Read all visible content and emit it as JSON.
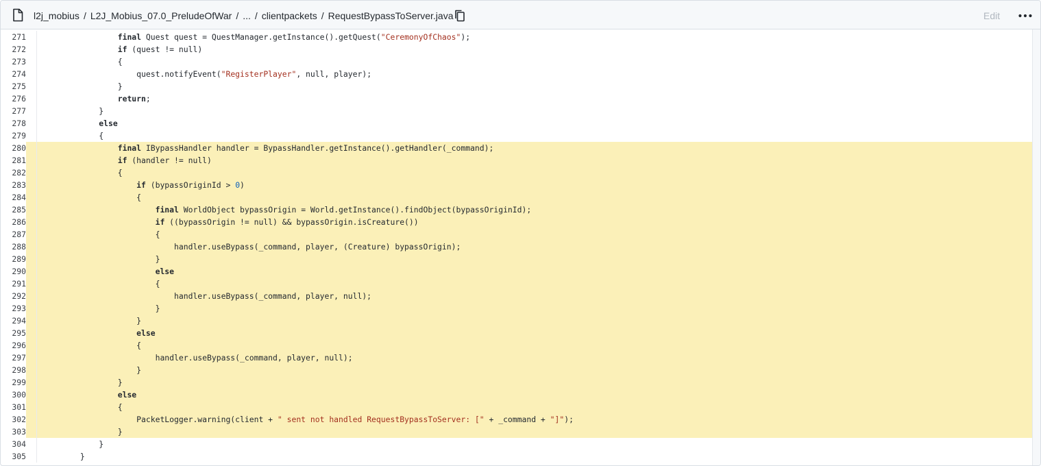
{
  "header": {
    "breadcrumbs": [
      {
        "label": "l2j_mobius"
      },
      {
        "label": "L2J_Mobius_07.0_PreludeOfWar"
      },
      {
        "label": "..."
      },
      {
        "label": "clientpackets"
      }
    ],
    "separator": "/",
    "current_file": "RequestBypassToServer.java",
    "edit_label": "Edit"
  },
  "icons": {
    "file": "file-icon",
    "copy": "copy-icon",
    "more": "kebab-horizontal-icon"
  },
  "colors": {
    "highlight": "#fbf0b8",
    "string": "#a3301f",
    "number": "#0b5fb8",
    "edit_disabled": "#b0b7bf"
  },
  "code": {
    "language": "java",
    "lines": [
      {
        "n": "271",
        "hl": false,
        "tokens": [
          [
            "",
            "\t\t\t\t"
          ],
          [
            "kw",
            "final"
          ],
          [
            "",
            " Quest quest = QuestManager.getInstance().getQuest("
          ],
          [
            "str",
            "\"CeremonyOfChaos\""
          ],
          [
            "",
            ");"
          ]
        ]
      },
      {
        "n": "272",
        "hl": false,
        "tokens": [
          [
            "",
            "\t\t\t\t"
          ],
          [
            "kw",
            "if"
          ],
          [
            "",
            " (quest != null)"
          ]
        ]
      },
      {
        "n": "273",
        "hl": false,
        "tokens": [
          [
            "",
            "\t\t\t\t{"
          ]
        ]
      },
      {
        "n": "274",
        "hl": false,
        "tokens": [
          [
            "",
            "\t\t\t\t\tquest.notifyEvent("
          ],
          [
            "str",
            "\"RegisterPlayer\""
          ],
          [
            "",
            ", null, player);"
          ]
        ]
      },
      {
        "n": "275",
        "hl": false,
        "tokens": [
          [
            "",
            "\t\t\t\t}"
          ]
        ]
      },
      {
        "n": "276",
        "hl": false,
        "tokens": [
          [
            "",
            "\t\t\t\t"
          ],
          [
            "kw",
            "return"
          ],
          [
            "",
            ";"
          ]
        ]
      },
      {
        "n": "277",
        "hl": false,
        "tokens": [
          [
            "",
            "\t\t\t}"
          ]
        ]
      },
      {
        "n": "278",
        "hl": false,
        "tokens": [
          [
            "",
            "\t\t\t"
          ],
          [
            "kw",
            "else"
          ]
        ]
      },
      {
        "n": "279",
        "hl": false,
        "tokens": [
          [
            "",
            "\t\t\t{"
          ]
        ]
      },
      {
        "n": "280",
        "hl": true,
        "tokens": [
          [
            "",
            "\t\t\t\t"
          ],
          [
            "kw",
            "final"
          ],
          [
            "",
            " IBypassHandler handler = BypassHandler.getInstance().getHandler(_command);"
          ]
        ]
      },
      {
        "n": "281",
        "hl": true,
        "tokens": [
          [
            "",
            "\t\t\t\t"
          ],
          [
            "kw",
            "if"
          ],
          [
            "",
            " (handler != null)"
          ]
        ]
      },
      {
        "n": "282",
        "hl": true,
        "tokens": [
          [
            "",
            "\t\t\t\t{"
          ]
        ]
      },
      {
        "n": "283",
        "hl": true,
        "tokens": [
          [
            "",
            "\t\t\t\t\t"
          ],
          [
            "kw",
            "if"
          ],
          [
            "",
            " (bypassOriginId > "
          ],
          [
            "num",
            "0"
          ],
          [
            "",
            ")"
          ]
        ]
      },
      {
        "n": "284",
        "hl": true,
        "tokens": [
          [
            "",
            "\t\t\t\t\t{"
          ]
        ]
      },
      {
        "n": "285",
        "hl": true,
        "tokens": [
          [
            "",
            "\t\t\t\t\t\t"
          ],
          [
            "kw",
            "final"
          ],
          [
            "",
            " WorldObject bypassOrigin = World.getInstance().findObject(bypassOriginId);"
          ]
        ]
      },
      {
        "n": "286",
        "hl": true,
        "tokens": [
          [
            "",
            "\t\t\t\t\t\t"
          ],
          [
            "kw",
            "if"
          ],
          [
            "",
            " ((bypassOrigin != null) && bypassOrigin.isCreature())"
          ]
        ]
      },
      {
        "n": "287",
        "hl": true,
        "tokens": [
          [
            "",
            "\t\t\t\t\t\t{"
          ]
        ]
      },
      {
        "n": "288",
        "hl": true,
        "tokens": [
          [
            "",
            "\t\t\t\t\t\t\thandler.useBypass(_command, player, (Creature) bypassOrigin);"
          ]
        ]
      },
      {
        "n": "289",
        "hl": true,
        "tokens": [
          [
            "",
            "\t\t\t\t\t\t}"
          ]
        ]
      },
      {
        "n": "290",
        "hl": true,
        "tokens": [
          [
            "",
            "\t\t\t\t\t\t"
          ],
          [
            "kw",
            "else"
          ]
        ]
      },
      {
        "n": "291",
        "hl": true,
        "tokens": [
          [
            "",
            "\t\t\t\t\t\t{"
          ]
        ]
      },
      {
        "n": "292",
        "hl": true,
        "tokens": [
          [
            "",
            "\t\t\t\t\t\t\thandler.useBypass(_command, player, null);"
          ]
        ]
      },
      {
        "n": "293",
        "hl": true,
        "tokens": [
          [
            "",
            "\t\t\t\t\t\t}"
          ]
        ]
      },
      {
        "n": "294",
        "hl": true,
        "tokens": [
          [
            "",
            "\t\t\t\t\t}"
          ]
        ]
      },
      {
        "n": "295",
        "hl": true,
        "tokens": [
          [
            "",
            "\t\t\t\t\t"
          ],
          [
            "kw",
            "else"
          ]
        ]
      },
      {
        "n": "296",
        "hl": true,
        "tokens": [
          [
            "",
            "\t\t\t\t\t{"
          ]
        ]
      },
      {
        "n": "297",
        "hl": true,
        "tokens": [
          [
            "",
            "\t\t\t\t\t\thandler.useBypass(_command, player, null);"
          ]
        ]
      },
      {
        "n": "298",
        "hl": true,
        "tokens": [
          [
            "",
            "\t\t\t\t\t}"
          ]
        ]
      },
      {
        "n": "299",
        "hl": true,
        "tokens": [
          [
            "",
            "\t\t\t\t}"
          ]
        ]
      },
      {
        "n": "300",
        "hl": true,
        "tokens": [
          [
            "",
            "\t\t\t\t"
          ],
          [
            "kw",
            "else"
          ]
        ]
      },
      {
        "n": "301",
        "hl": true,
        "tokens": [
          [
            "",
            "\t\t\t\t{"
          ]
        ]
      },
      {
        "n": "302",
        "hl": true,
        "tokens": [
          [
            "",
            "\t\t\t\t\tPacketLogger.warning(client + "
          ],
          [
            "str",
            "\" sent not handled RequestBypassToServer: [\""
          ],
          [
            "",
            " + _command + "
          ],
          [
            "str",
            "\"]\""
          ],
          [
            "",
            ");"
          ]
        ]
      },
      {
        "n": "303",
        "hl": true,
        "tokens": [
          [
            "",
            "\t\t\t\t}"
          ]
        ]
      },
      {
        "n": "304",
        "hl": false,
        "tokens": [
          [
            "",
            "\t\t\t}"
          ]
        ]
      },
      {
        "n": "305",
        "hl": false,
        "tokens": [
          [
            "",
            "\t\t}"
          ]
        ]
      }
    ]
  }
}
